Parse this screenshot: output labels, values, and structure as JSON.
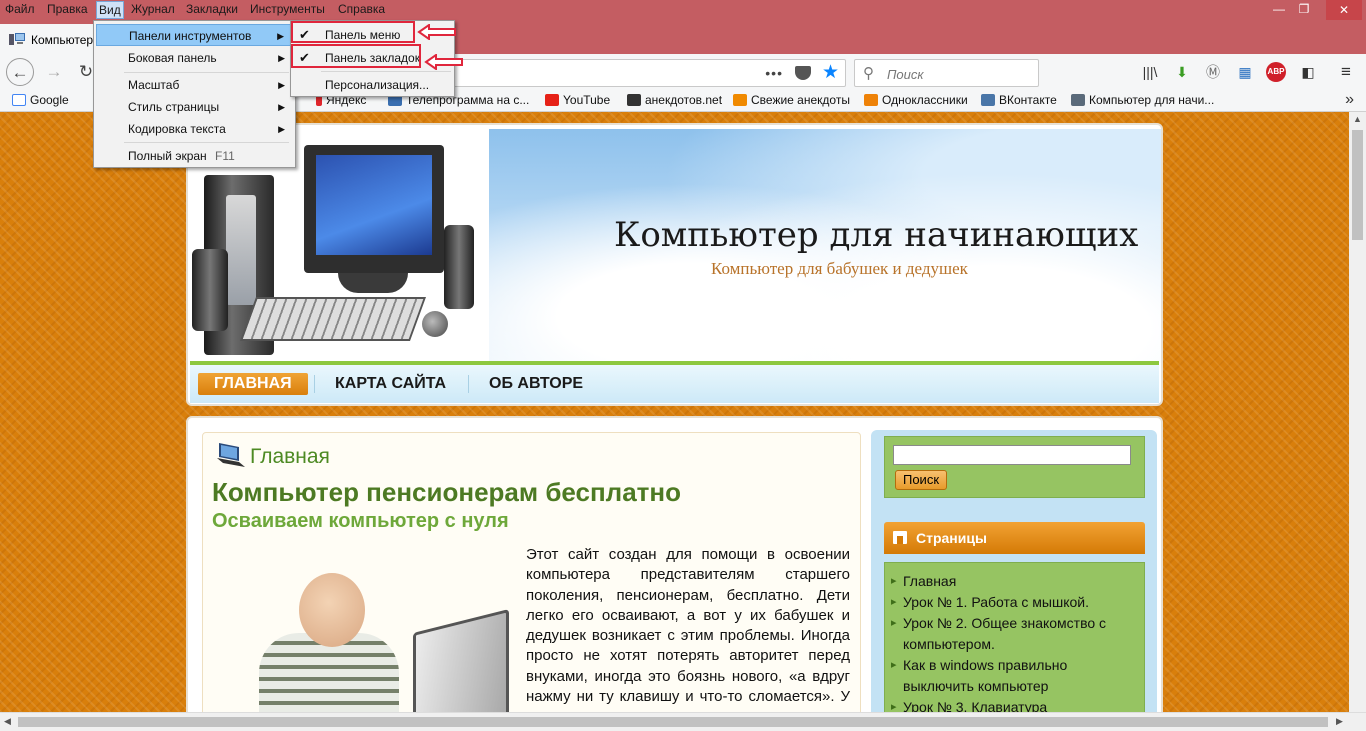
{
  "menubar": {
    "items": [
      "Файл",
      "Правка",
      "Вид",
      "Журнал",
      "Закладки",
      "Инструменты",
      "Справка"
    ],
    "active": "Вид"
  },
  "window": {
    "minimize": "—",
    "restore": "❐",
    "close": "✕"
  },
  "tab": {
    "title": "Компьютер"
  },
  "urlbar": {
    "value": ""
  },
  "searchbar": {
    "placeholder": "Поиск"
  },
  "bookmarks": [
    {
      "label": "Google",
      "color": "#4285f4"
    },
    {
      "label": "Яндекс",
      "color": "#e0262c"
    },
    {
      "label": "Телепрограмма на с...",
      "color": "#3a6fb0"
    },
    {
      "label": "YouTube",
      "color": "#e62117"
    },
    {
      "label": "анекдотов.net",
      "color": "#333333"
    },
    {
      "label": "Свежие анекдоты",
      "color": "#f08a00"
    },
    {
      "label": "Одноклассники",
      "color": "#ee8208"
    },
    {
      "label": "ВКонтакте",
      "color": "#4a76a8"
    },
    {
      "label": "Компьютер для начи...",
      "color": "#5a6a7a"
    }
  ],
  "view_menu": {
    "items": [
      {
        "label": "Панели инструментов",
        "submenu": true,
        "highlighted": true
      },
      {
        "label": "Боковая панель",
        "submenu": true
      },
      {
        "label": "Масштаб",
        "submenu": true
      },
      {
        "label": "Стиль страницы",
        "submenu": true
      },
      {
        "label": "Кодировка текста",
        "submenu": true
      },
      {
        "label": "Полный экран",
        "accel": "F11"
      }
    ]
  },
  "toolbars_submenu": {
    "items": [
      {
        "label": "Панель меню",
        "checked": true
      },
      {
        "label": "Панель закладок",
        "checked": true
      },
      {
        "label": "Персонализация..."
      }
    ]
  },
  "site": {
    "title": "Компьютер для начинающих",
    "tagline": "Компьютер для бабушек и дедушек",
    "nav": [
      "ГЛАВНАЯ",
      "КАРТА САЙТА",
      "ОБ АВТОРЕ"
    ]
  },
  "post": {
    "crumb": "Главная",
    "heading": "Компьютер пенсионерам бесплатно",
    "subheading": "Осваиваем компьютер с нуля",
    "text": "Этот сайт создан для помощи в освоении компьютера представителям старшего поколения, пенсионерам, бесплатно. Дети легко его осваивают, а вот у их бабушек и дедушек возникает с этим проблемы. Иногда просто не хотят потерять авторитет перед внуками, иногда это боязнь нового, «а вдруг нажму ни ту клавишу и что-то сломается». У внуков и"
  },
  "sidebar": {
    "search_button": "Поиск",
    "pages_title": "Страницы",
    "pages": [
      "Главная",
      "Урок № 1. Работа с мышкой.",
      "Урок № 2. Общее знакомство с компьютером.",
      "Как в windows правильно выключить компьютер",
      "Урок № 3. Клавиатура"
    ]
  },
  "colors": {
    "accent_red": "#e0263c",
    "page_orange": "#d97f0b",
    "menu_highlight": "#91c9f7"
  }
}
